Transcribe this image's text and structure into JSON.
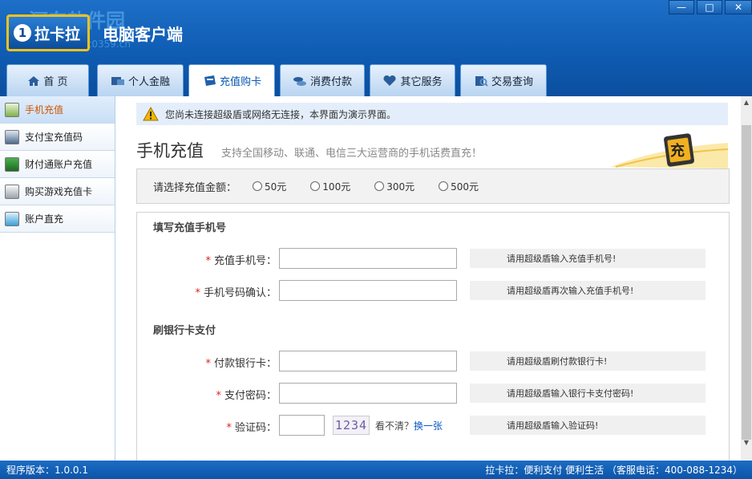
{
  "header": {
    "logo_number": "1",
    "logo_text": "拉卡拉",
    "app_title": "电脑客户端",
    "watermark": "河东软件园",
    "watermark_url": "www.pc0359.cn"
  },
  "window_controls": {
    "minimize": "—",
    "maximize": "□",
    "close": "✕"
  },
  "tabs": [
    {
      "label": "首 页",
      "icon": "home-icon"
    },
    {
      "label": "个人金融",
      "icon": "finance-icon"
    },
    {
      "label": "充值购卡",
      "icon": "card-icon",
      "active": true
    },
    {
      "label": "消费付款",
      "icon": "coins-icon"
    },
    {
      "label": "其它服务",
      "icon": "heart-icon"
    },
    {
      "label": "交易查询",
      "icon": "query-icon"
    }
  ],
  "sidebar": {
    "items": [
      {
        "label": "手机充值",
        "active": true,
        "icon": "phone-recharge-icon"
      },
      {
        "label": "支付宝充值码",
        "icon": "alipay-icon"
      },
      {
        "label": "财付通账户充值",
        "icon": "tenpay-icon"
      },
      {
        "label": "购买游戏充值卡",
        "icon": "game-card-icon"
      },
      {
        "label": "账户直充",
        "icon": "account-icon"
      }
    ]
  },
  "main": {
    "warning": "您尚未连接超级盾或网络无连接，本界面为演示界面。",
    "title": "手机充值",
    "subtitle": "支持全国移动、联通、电信三大运营商的手机话费直充！",
    "banner_char": "充",
    "amount_label": "请选择充值金额：",
    "amounts": [
      "50元",
      "100元",
      "300元",
      "500元"
    ],
    "section_phone": "填写充值手机号",
    "section_card": "刷银行卡支付",
    "fields": {
      "phone": {
        "label": "充值手机号：",
        "hint": "请用超级盾输入充值手机号!",
        "value": ""
      },
      "phone_confirm": {
        "label": "手机号码确认：",
        "hint": "请用超级盾再次输入充值手机号!",
        "value": ""
      },
      "bank_card": {
        "label": "付款银行卡：",
        "hint": "请用超级盾刷付款银行卡!",
        "value": ""
      },
      "pay_password": {
        "label": "支付密码：",
        "hint": "请用超级盾输入银行卡支付密码!",
        "value": ""
      },
      "captcha": {
        "label": "验证码：",
        "hint": "请用超级盾输入验证码!",
        "value": "",
        "image_text": "1234",
        "cant_see": "看不清？",
        "refresh": "换一张"
      }
    },
    "required_mark": "*"
  },
  "statusbar": {
    "version": "程序版本：1.0.0.1",
    "right": "拉卡拉：便利支付 便利生活 （客服电话：400-088-1234）"
  },
  "colors": {
    "header_blue": "#0f5cb3",
    "accent_orange": "#d05400",
    "required_red": "#dd2222",
    "link_blue": "#0a59c8"
  }
}
